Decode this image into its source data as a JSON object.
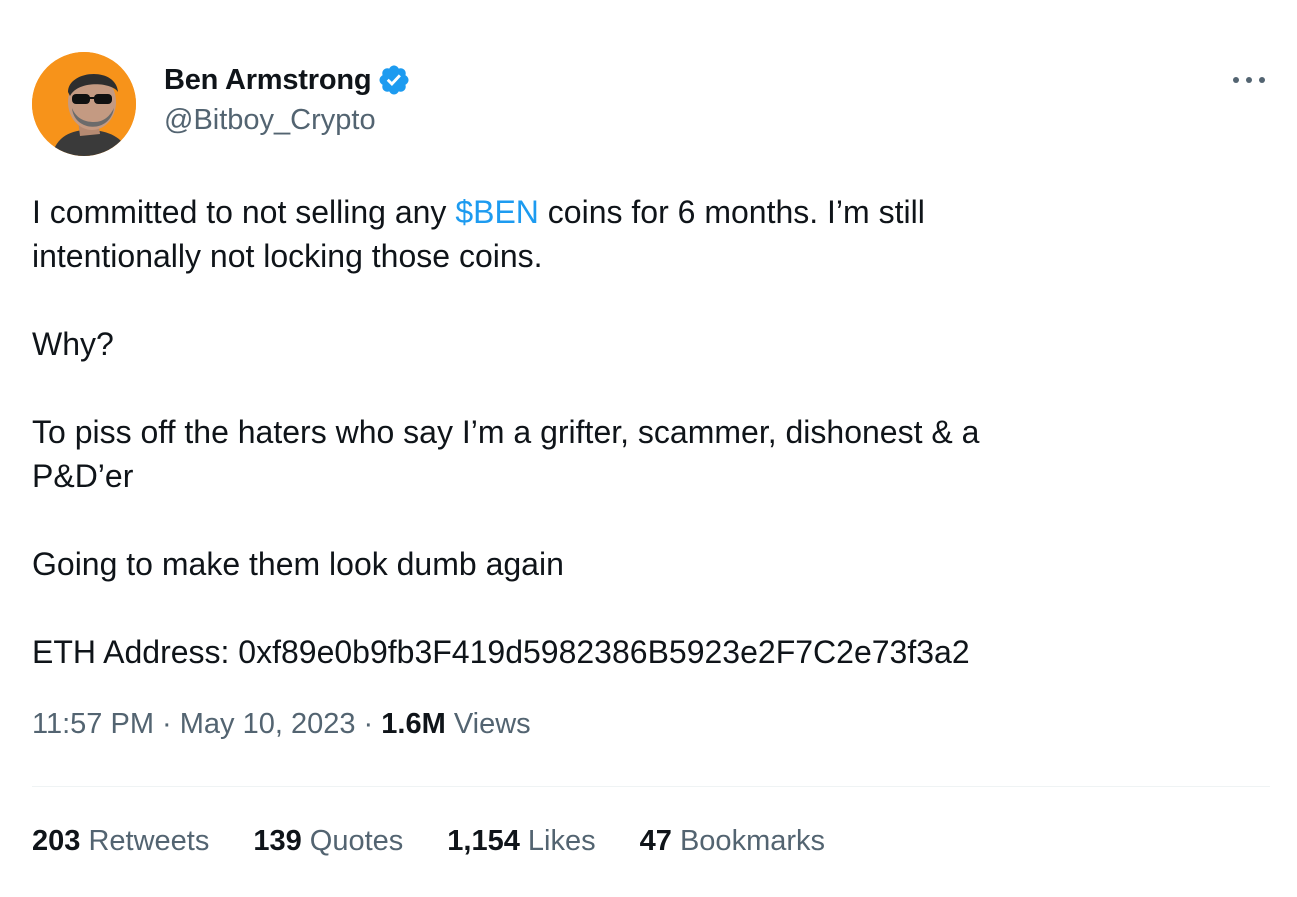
{
  "author": {
    "display_name": "Ben Armstrong",
    "handle": "@Bitboy_Crypto",
    "avatar_icon": "user-avatar",
    "verified_icon": "verified-badge-icon",
    "verified_color": "#1d9bf0"
  },
  "more_icon": "more-options-icon",
  "body": {
    "line1_pre": "I committed to not selling any ",
    "line1_cashtag": "$BEN",
    "line1_post": " coins for 6 months. I’m still",
    "line2": "intentionally not locking those coins.",
    "para2": "Why?",
    "para3_line1": "To piss off the haters who say I’m a grifter, scammer, dishonest & a",
    "para3_line2": "P&D’er",
    "para4": "Going to make them look dumb again",
    "para5": "ETH Address: 0xf89e0b9fb3F419d5982386B5923e2F7C2e73f3a2"
  },
  "meta": {
    "time": "11:57 PM",
    "sep1": " · ",
    "date": "May 10, 2023",
    "sep2": " · ",
    "views_count": "1.6M",
    "views_label": " Views"
  },
  "stats": [
    {
      "count": "203",
      "label": " Retweets"
    },
    {
      "count": "139",
      "label": " Quotes"
    },
    {
      "count": "1,154",
      "label": " Likes"
    },
    {
      "count": "47",
      "label": " Bookmarks"
    }
  ],
  "colors": {
    "text": "#0f1419",
    "secondary": "#536471",
    "link": "#1d9bf0",
    "avatar_bg": "#f7931a",
    "divider": "#eff3f4"
  }
}
